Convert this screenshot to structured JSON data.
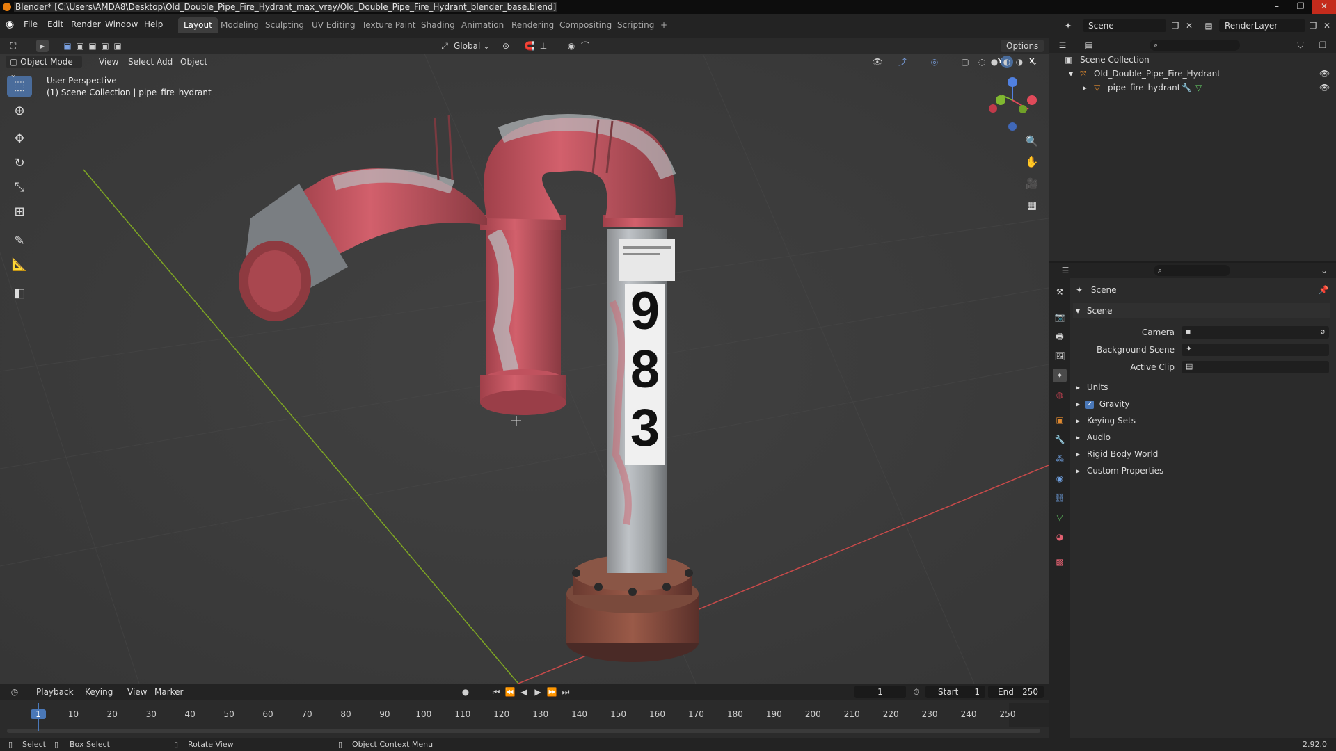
{
  "window": {
    "title": "Blender* [C:\\Users\\AMDA8\\Desktop\\Old_Double_Pipe_Fire_Hydrant_max_vray/Old_Double_Pipe_Fire_Hydrant_blender_base.blend]"
  },
  "menu": [
    "File",
    "Edit",
    "Render",
    "Window",
    "Help"
  ],
  "workspaces": [
    "Layout",
    "Modeling",
    "Sculpting",
    "UV Editing",
    "Texture Paint",
    "Shading",
    "Animation",
    "Rendering",
    "Compositing",
    "Scripting",
    "+"
  ],
  "scene_field": "Scene",
  "renderlayer_field": "RenderLayer",
  "toolheader": {
    "transform_orientation": "Global",
    "options_label": "Options"
  },
  "viewport": {
    "mode": "Object Mode",
    "menus": [
      "View",
      "Select",
      "Add",
      "Object"
    ],
    "overlay_line1": "User Perspective",
    "overlay_line2": "(1) Scene Collection | pipe_fire_hydrant",
    "hydrant_digits": [
      "9",
      "8",
      "3"
    ],
    "gizmo": {
      "x": "X",
      "y": "Y",
      "z": "Z"
    }
  },
  "outliner": {
    "root": "Scene Collection",
    "collection": "Old_Double_Pipe_Fire_Hydrant",
    "object": "pipe_fire_hydrant"
  },
  "properties": {
    "header": "Scene",
    "panel_title": "Scene",
    "camera_label": "Camera",
    "bg_scene_label": "Background Scene",
    "active_clip_label": "Active Clip",
    "panels": [
      "Units",
      "Gravity",
      "Keying Sets",
      "Audio",
      "Rigid Body World",
      "Custom Properties"
    ]
  },
  "timeline": {
    "menus": [
      "Playback",
      "Keying",
      "View",
      "Marker"
    ],
    "current_frame": "1",
    "start_label": "Start",
    "start_value": "1",
    "end_label": "End",
    "end_value": "250",
    "ticks": [
      "1",
      "10",
      "20",
      "30",
      "40",
      "50",
      "60",
      "70",
      "80",
      "90",
      "100",
      "110",
      "120",
      "130",
      "140",
      "150",
      "160",
      "170",
      "180",
      "190",
      "200",
      "210",
      "220",
      "230",
      "240",
      "250"
    ]
  },
  "status": {
    "select": "Select",
    "box_select": "Box Select",
    "rotate_view": "Rotate View",
    "context_menu": "Object Context Menu",
    "version": "2.92.0"
  }
}
